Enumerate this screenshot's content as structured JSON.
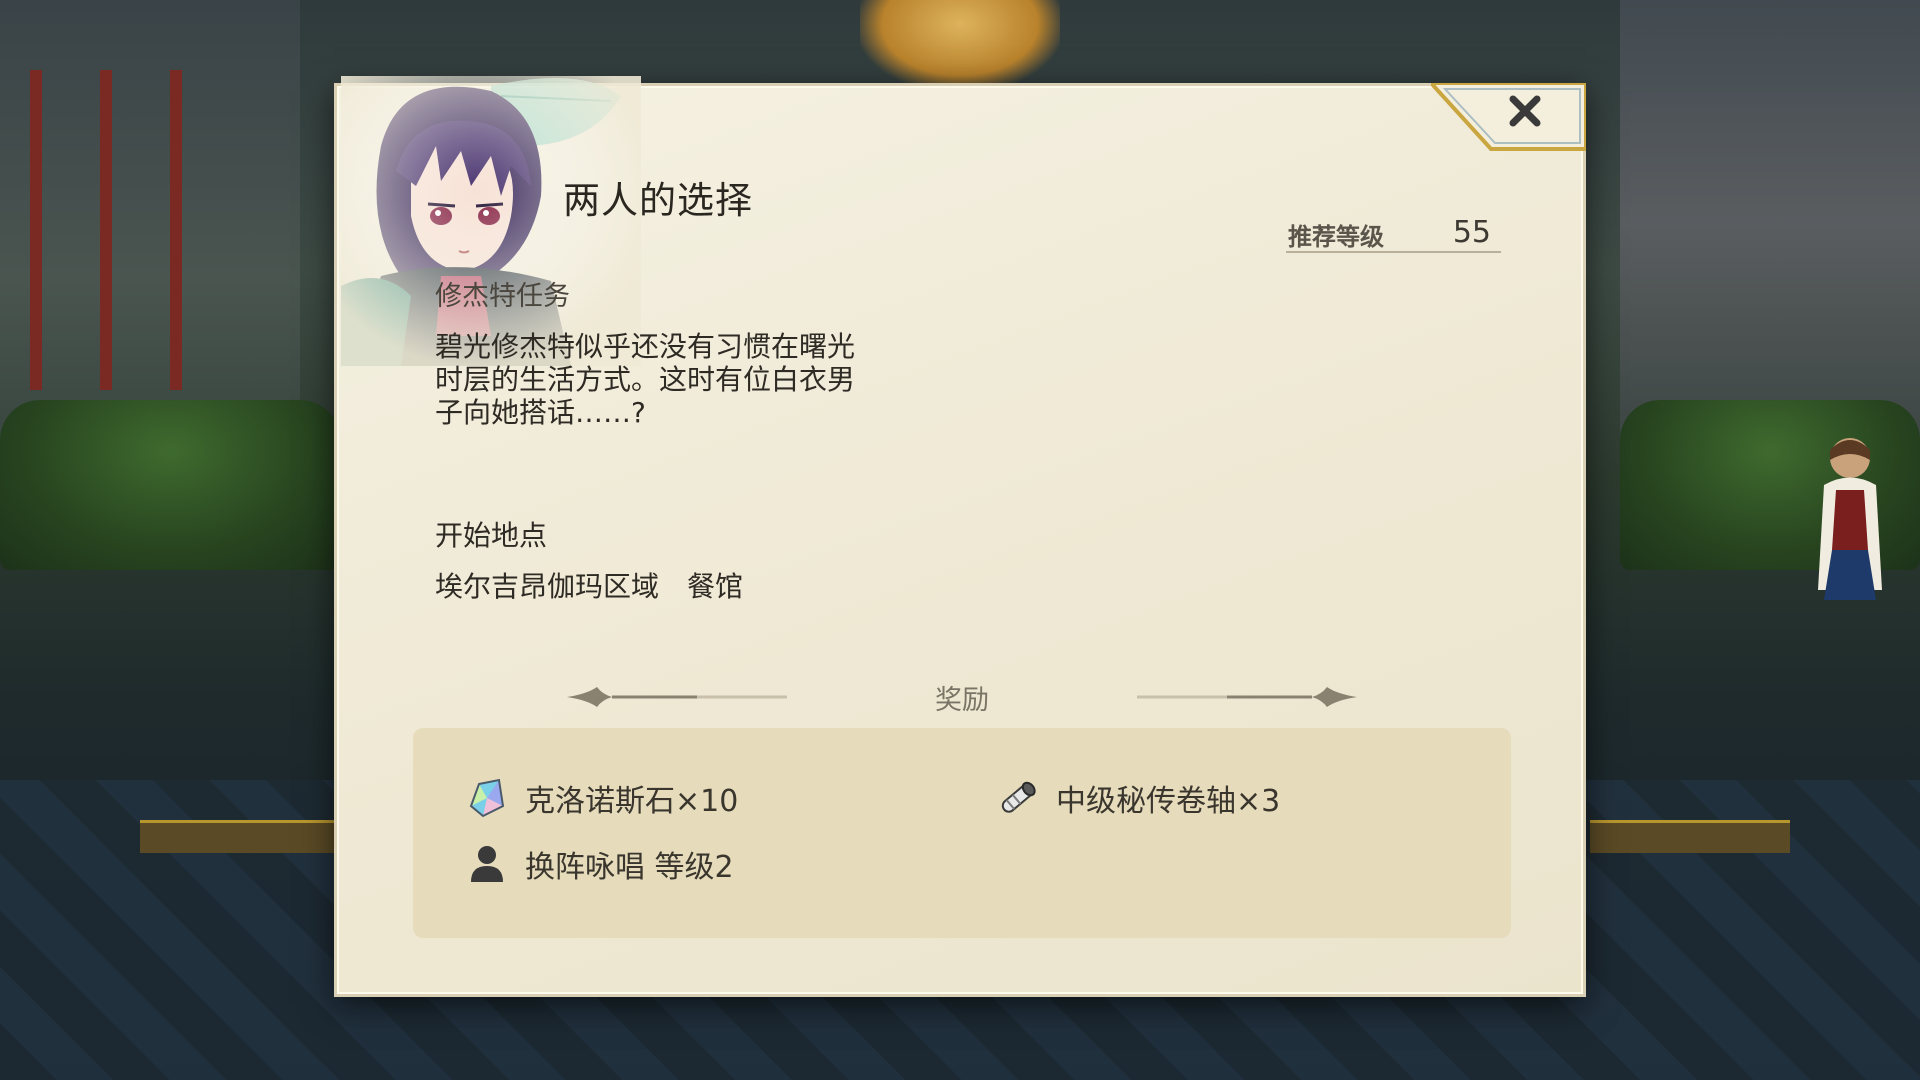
{
  "quest": {
    "title": "两人的选择",
    "category": "修杰特任务",
    "description": "碧光修杰特似乎还没有习惯在曙光时层的生活方式。这时有位白衣男子向她搭话……?",
    "recommended_level_label": "推荐等级",
    "recommended_level": "55",
    "start_label": "开始地点",
    "start_location": "埃尔吉昂伽玛区域　餐馆"
  },
  "rewards": {
    "title": "奖励",
    "items": [
      {
        "label": "克洛诺斯石×10",
        "icon": "crystal-icon"
      },
      {
        "label": "中级秘传卷轴×3",
        "icon": "scroll-icon"
      },
      {
        "label": "换阵咏唱 等级2",
        "icon": "person-icon"
      }
    ]
  },
  "close_button": {
    "icon": "close-icon"
  },
  "colors": {
    "panel": "#efe9d5",
    "reward_box": "#e6dcbc",
    "close_accent": "#c9a640"
  }
}
